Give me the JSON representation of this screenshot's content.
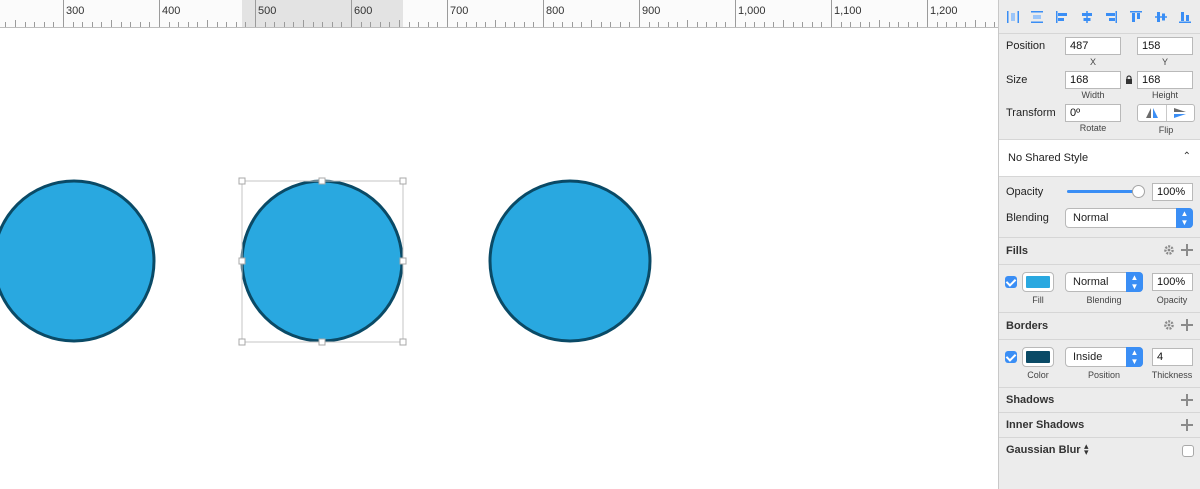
{
  "ruler": {
    "labels": [
      "300",
      "400",
      "500",
      "600",
      "700",
      "800",
      "900",
      "1,000",
      "1,100",
      "1,200"
    ]
  },
  "inspector": {
    "position": {
      "label": "Position",
      "x": "487",
      "y": "158",
      "x_label": "X",
      "y_label": "Y"
    },
    "size": {
      "label": "Size",
      "width": "168",
      "height": "168",
      "width_label": "Width",
      "height_label": "Height"
    },
    "transform": {
      "label": "Transform",
      "rotate": "0º",
      "rotate_label": "Rotate",
      "flip_label": "Flip"
    },
    "shared_style": {
      "value": "No Shared Style"
    },
    "opacity": {
      "label": "Opacity",
      "value": "100%",
      "level": 1.0
    },
    "blending": {
      "label": "Blending",
      "value": "Normal"
    },
    "fills": {
      "title": "Fills",
      "color": "#29a8e0",
      "blending": "Normal",
      "opacity": "100%",
      "fill_label": "Fill",
      "blending_label": "Blending",
      "opacity_label": "Opacity"
    },
    "borders": {
      "title": "Borders",
      "color": "#0a4a66",
      "position": "Inside",
      "thickness": "4",
      "color_label": "Color",
      "position_label": "Position",
      "thickness_label": "Thickness"
    },
    "shadows": {
      "title": "Shadows"
    },
    "inner_shadows": {
      "title": "Inner Shadows"
    },
    "gaussian_blur": {
      "title": "Gaussian Blur"
    }
  },
  "colors": {
    "accent": "#3a8ef5",
    "circle_fill": "#29a8e0",
    "circle_stroke": "#0a4a66"
  }
}
